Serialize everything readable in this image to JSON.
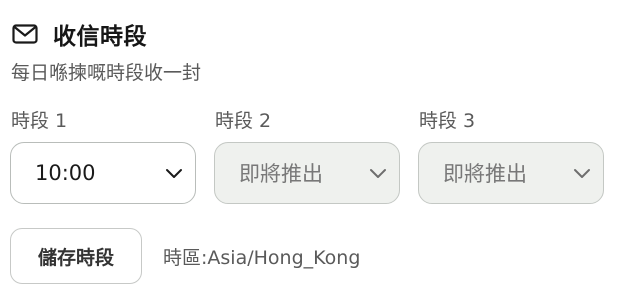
{
  "header": {
    "icon": "mail-icon",
    "title": "收信時段",
    "subtitle": "每日喺揀嘅時段收一封"
  },
  "slots": [
    {
      "label": "時段 1",
      "value": "10:00",
      "disabled": false
    },
    {
      "label": "時段 2",
      "value": "即將推出",
      "disabled": true
    },
    {
      "label": "時段 3",
      "value": "即將推出",
      "disabled": true
    }
  ],
  "actions": {
    "save_label": "儲存時段"
  },
  "timezone": {
    "text": "時區:Asia/Hong_Kong"
  },
  "colors": {
    "disabled_bg": "#eff1ee",
    "border": "#b9bdba",
    "muted_text": "#5a5a5a"
  }
}
